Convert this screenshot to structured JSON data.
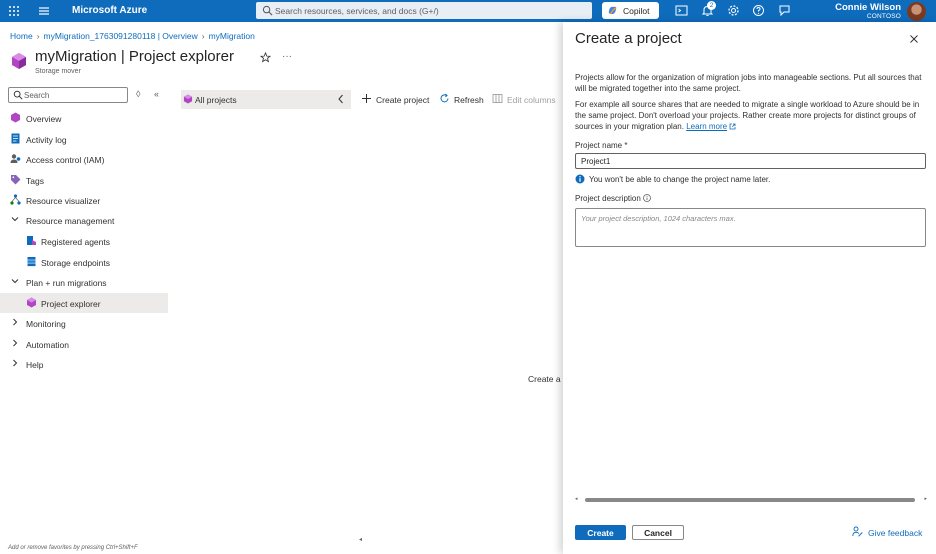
{
  "topbar": {
    "brand": "Microsoft Azure",
    "search_placeholder": "Search resources, services, and docs (G+/)",
    "copilot_label": "Copilot",
    "notification_count": "2",
    "user_name": "Connie Wilson",
    "user_org": "CONTOSO",
    "icons": [
      "waffle-icon",
      "menu-icon",
      "cloud-shell-icon",
      "notifications-icon",
      "settings-icon",
      "help-icon",
      "feedback-icon"
    ]
  },
  "breadcrumb": {
    "items": [
      "Home",
      "myMigration_1763091280118 | Overview",
      "myMigration"
    ]
  },
  "page": {
    "title": "myMigration | Project explorer",
    "subtitle": "Storage mover"
  },
  "sidebar": {
    "search_placeholder": "Search",
    "items": [
      {
        "label": "Overview",
        "icon": "overview-icon"
      },
      {
        "label": "Activity log",
        "icon": "activity-log-icon"
      },
      {
        "label": "Access control (IAM)",
        "icon": "access-control-icon"
      },
      {
        "label": "Tags",
        "icon": "tags-icon"
      },
      {
        "label": "Resource visualizer",
        "icon": "resource-visualizer-icon"
      },
      {
        "label": "Resource management",
        "icon": "chevron-down-icon"
      },
      {
        "label": "Registered agents",
        "icon": "registered-agents-icon"
      },
      {
        "label": "Storage endpoints",
        "icon": "storage-endpoints-icon"
      },
      {
        "label": "Plan + run migrations",
        "icon": "chevron-down-icon"
      },
      {
        "label": "Project explorer",
        "icon": "project-explorer-icon"
      },
      {
        "label": "Monitoring",
        "icon": "chevron-right-icon"
      },
      {
        "label": "Automation",
        "icon": "chevron-right-icon"
      },
      {
        "label": "Help",
        "icon": "chevron-right-icon"
      }
    ],
    "favorites_hint": "Add or remove favorites by pressing Ctrl+Shift+F"
  },
  "main": {
    "all_projects_label": "All projects",
    "commands": {
      "create": "Create project",
      "refresh": "Refresh",
      "edit_columns": "Edit columns"
    },
    "empty_message": "Create a p"
  },
  "panel": {
    "title": "Create a project",
    "intro": "Projects allow for the organization of migration jobs into manageable sections. Put all sources that will be migrated together into the same project.",
    "example": "For example all source shares that are needed to migrate a single workload to Azure should be in the same project. Don't overload your projects. Rather create more projects for distinct groups of sources in your migration plan.",
    "learn_more": "Learn more",
    "name_label": "Project name *",
    "name_value": "Project1",
    "name_info": "You won't be able to change the project name later.",
    "description_label": "Project description",
    "description_placeholder": "Your project description, 1024 characters max.",
    "create_button": "Create",
    "cancel_button": "Cancel",
    "feedback_label": "Give feedback"
  },
  "colors": {
    "accent": "#0f6cbd",
    "selected_nav_bg": "#edebe9"
  }
}
